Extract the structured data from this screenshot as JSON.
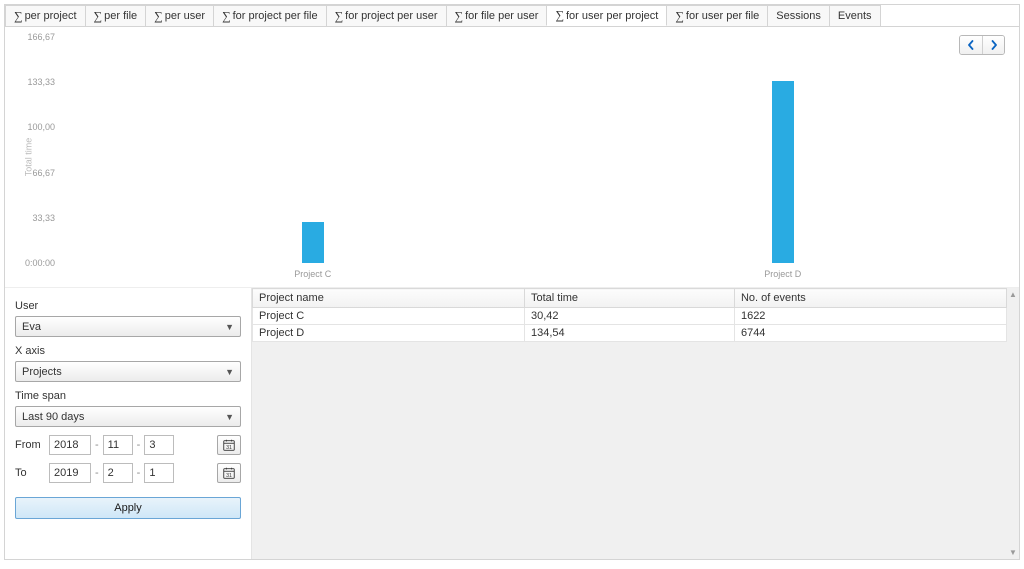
{
  "tabs": [
    {
      "label": "per project",
      "sigma": true
    },
    {
      "label": "per file",
      "sigma": true
    },
    {
      "label": "per user",
      "sigma": true
    },
    {
      "label": "for project per file",
      "sigma": true
    },
    {
      "label": "for project per user",
      "sigma": true
    },
    {
      "label": "for file per user",
      "sigma": true
    },
    {
      "label": "for user per project",
      "sigma": true,
      "active": true
    },
    {
      "label": "for user per file",
      "sigma": true
    },
    {
      "label": "Sessions",
      "sigma": false
    },
    {
      "label": "Events",
      "sigma": false
    }
  ],
  "chart_data": {
    "type": "bar",
    "categories": [
      "Project C",
      "Project D"
    ],
    "values": [
      30.42,
      134.54
    ],
    "ylabel": "Total time",
    "ylim": [
      0,
      166.67
    ],
    "yticks": [
      "0:00:00",
      "33,33",
      "66,67",
      "100,00",
      "133,33",
      "166,67"
    ]
  },
  "nav": {
    "prev": "‹",
    "next": "›"
  },
  "sidebar": {
    "user_label": "User",
    "user_value": "Eva",
    "xaxis_label": "X axis",
    "xaxis_value": "Projects",
    "timespan_label": "Time span",
    "timespan_value": "Last 90 days",
    "from_label": "From",
    "from_y": "2018",
    "from_m": "11",
    "from_d": "3",
    "to_label": "To",
    "to_y": "2019",
    "to_m": "2",
    "to_d": "1",
    "apply_label": "Apply"
  },
  "table": {
    "headers": [
      "Project name",
      "Total time",
      "No. of events"
    ],
    "rows": [
      [
        "Project C",
        "30,42",
        "1622"
      ],
      [
        "Project D",
        "134,54",
        "6744"
      ]
    ]
  }
}
